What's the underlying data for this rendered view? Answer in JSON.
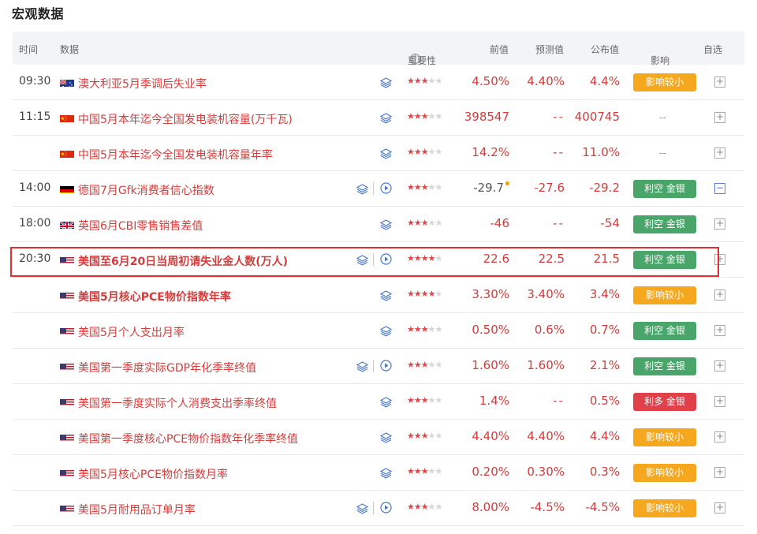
{
  "page_title": "宏观数据",
  "header": {
    "time": "时间",
    "data": "数据",
    "importance": "重要性",
    "importance_help": "?",
    "previous": "前值",
    "forecast": "预测值",
    "actual": "公布值",
    "effect": "影响",
    "effect_caret": "▾",
    "watchlist": "自选"
  },
  "rows": [
    {
      "time": "09:30",
      "flag": "AU",
      "name": "澳大利亚5月季调后失业率",
      "bold": false,
      "video": false,
      "stars": 3,
      "previous": "4.50%",
      "forecast": "4.40%",
      "actual": "4.4%",
      "effect": "影响较小",
      "effect_color": "orange",
      "watch": "+"
    },
    {
      "time": "11:15",
      "flag": "CN",
      "name": "中国5月本年迄今全国发电装机容量(万千瓦)",
      "bold": false,
      "video": false,
      "stars": 3,
      "previous": "398547",
      "forecast": "--",
      "actual": "400745",
      "effect": "--",
      "effect_color": "none",
      "watch": "+"
    },
    {
      "time": "",
      "flag": "CN",
      "name": "中国5月本年迄今全国发电装机容量年率",
      "bold": false,
      "video": false,
      "stars": 3,
      "previous": "14.2%",
      "forecast": "--",
      "actual": "11.0%",
      "effect": "--",
      "effect_color": "none",
      "watch": "+"
    },
    {
      "time": "14:00",
      "flag": "DE",
      "name": "德国7月Gfk消费者信心指数",
      "bold": false,
      "video": true,
      "stars": 3,
      "previous": "-29.7",
      "previous_revised": true,
      "forecast": "-27.6",
      "actual": "-29.2",
      "effect": "利空 金银",
      "effect_color": "green",
      "watch": "−"
    },
    {
      "time": "18:00",
      "flag": "GB",
      "name": "英国6月CBI零售销售差值",
      "bold": false,
      "video": false,
      "stars": 3,
      "previous": "-46",
      "forecast": "--",
      "actual": "-54",
      "effect": "利空 金银",
      "effect_color": "green",
      "watch": "+"
    },
    {
      "time": "20:30",
      "flag": "US",
      "name": "美国至6月20日当周初请失业金人数(万人)",
      "bold": true,
      "video": true,
      "stars": 4,
      "previous": "22.6",
      "forecast": "22.5",
      "actual": "21.5",
      "effect": "利空 金银",
      "effect_color": "green",
      "watch": "+"
    },
    {
      "time": "",
      "flag": "US",
      "name": "美国5月核心PCE物价指数年率",
      "bold": true,
      "video": false,
      "stars": 4,
      "previous": "3.30%",
      "forecast": "3.40%",
      "actual": "3.4%",
      "effect": "影响较小",
      "effect_color": "orange",
      "watch": "+"
    },
    {
      "time": "",
      "flag": "US",
      "name": "美国5月个人支出月率",
      "bold": false,
      "video": false,
      "stars": 3,
      "previous": "0.50%",
      "forecast": "0.6%",
      "actual": "0.7%",
      "effect": "利空 金银",
      "effect_color": "green",
      "watch": "+"
    },
    {
      "time": "",
      "flag": "US",
      "name": "美国第一季度实际GDP年化季率终值",
      "bold": false,
      "video": true,
      "stars": 3,
      "previous": "1.60%",
      "forecast": "1.60%",
      "actual": "2.1%",
      "effect": "利空 金银",
      "effect_color": "green",
      "watch": "+"
    },
    {
      "time": "",
      "flag": "US",
      "name": "美国第一季度实际个人消费支出季率终值",
      "bold": false,
      "video": false,
      "stars": 3,
      "previous": "1.4%",
      "forecast": "--",
      "actual": "0.5%",
      "effect": "利多 金银",
      "effect_color": "red",
      "watch": "+"
    },
    {
      "time": "",
      "flag": "US",
      "name": "美国第一季度核心PCE物价指数年化季率终值",
      "bold": false,
      "video": false,
      "stars": 3,
      "previous": "4.40%",
      "forecast": "4.40%",
      "actual": "4.4%",
      "effect": "影响较小",
      "effect_color": "orange",
      "watch": "+"
    },
    {
      "time": "",
      "flag": "US",
      "name": "美国5月核心PCE物价指数月率",
      "bold": false,
      "video": false,
      "stars": 3,
      "previous": "0.20%",
      "forecast": "0.30%",
      "actual": "0.3%",
      "effect": "影响较小",
      "effect_color": "orange",
      "watch": "+"
    },
    {
      "time": "",
      "flag": "US",
      "name": "美国5月耐用品订单月率",
      "bold": false,
      "video": true,
      "stars": 3,
      "previous": "8.00%",
      "forecast": "-4.5%",
      "actual": "-4.5%",
      "effect": "影响较小",
      "effect_color": "orange",
      "watch": "+"
    }
  ]
}
